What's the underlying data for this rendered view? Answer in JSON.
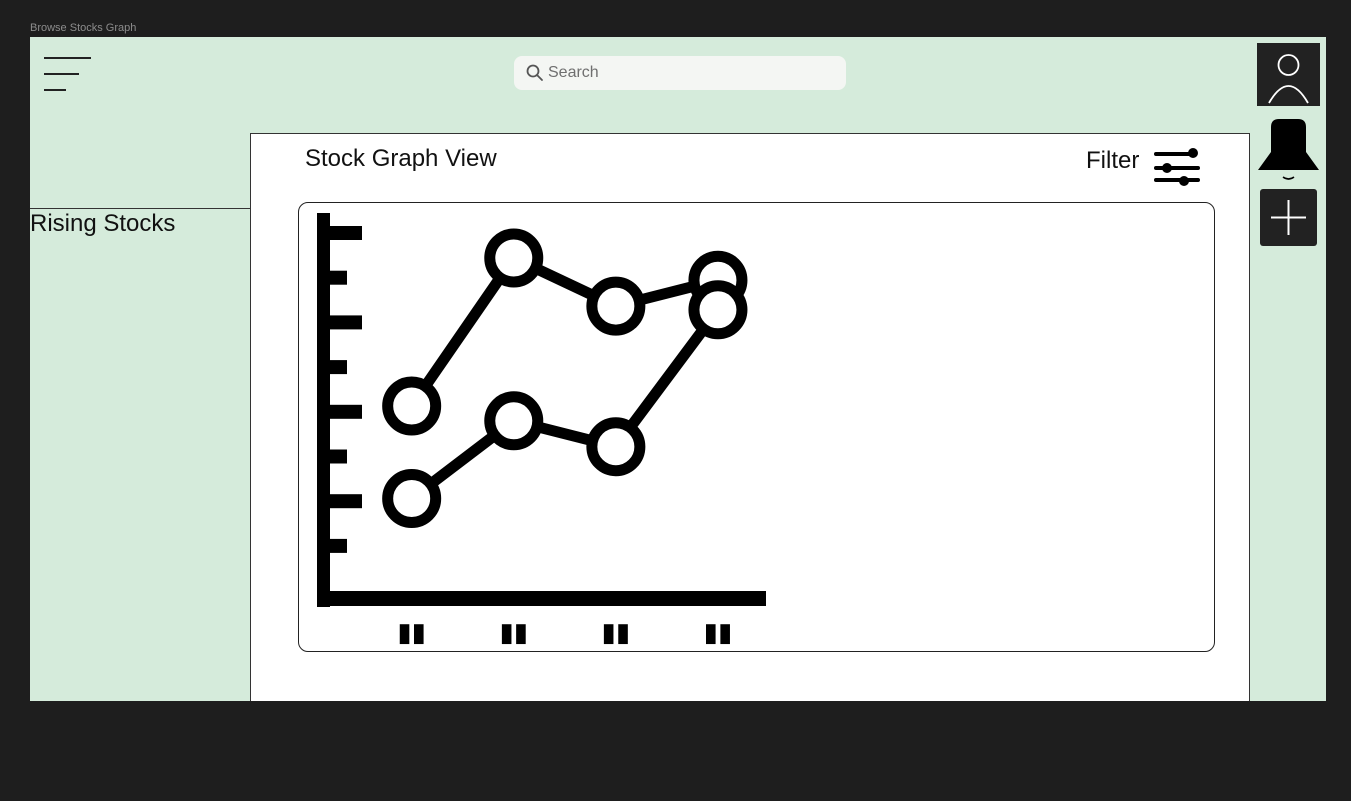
{
  "window": {
    "title": "Browse Stocks Graph"
  },
  "header": {
    "search": {
      "placeholder": "Search",
      "value": ""
    }
  },
  "sidebar": {
    "title": "Rising Stocks"
  },
  "main": {
    "title": "Stock Graph View",
    "filter_label": "Filter"
  },
  "right_toolbar": {
    "icons": [
      "user-icon",
      "bell-icon",
      "plus-icon"
    ]
  },
  "chart_data": {
    "type": "line",
    "x": [
      1,
      2,
      3,
      4
    ],
    "series": [
      {
        "values": [
          5.0,
          9.0,
          7.7,
          8.4
        ]
      },
      {
        "values": [
          2.5,
          4.6,
          3.9,
          7.6
        ]
      }
    ],
    "ylim": [
      0,
      10
    ],
    "xlim": [
      0.2,
      4.5
    ],
    "xtick_labels": [
      "▮▮",
      "▮▮",
      "▮▮",
      "▮▮"
    ],
    "grid": false,
    "legend": "none"
  },
  "colors": {
    "background": "#d5ebdb",
    "panel": "#ffffff",
    "ink": "#000000"
  }
}
